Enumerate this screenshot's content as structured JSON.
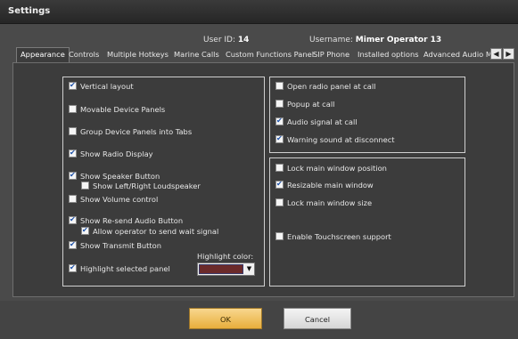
{
  "window": {
    "title": "Settings"
  },
  "user": {
    "id_label": "User ID:",
    "id_value": "14",
    "username_label": "Username:",
    "username_value": "Mimer Operator 13"
  },
  "tabs": [
    {
      "label": "Appearance",
      "active": true
    },
    {
      "label": "Controls"
    },
    {
      "label": "Multiple Hotkeys"
    },
    {
      "label": "Marine Calls"
    },
    {
      "label": "Custom Functions Panel"
    },
    {
      "label": "SIP Phone"
    },
    {
      "label": "Installed options"
    },
    {
      "label": "Advanced Audio Me"
    }
  ],
  "left_options": [
    {
      "label": "Vertical layout",
      "checked": true
    },
    {
      "label": "Movable Device Panels",
      "checked": false
    },
    {
      "label": "Group Device Panels into Tabs",
      "checked": false
    },
    {
      "label": "Show Radio Display",
      "checked": true
    },
    {
      "label": "Show Speaker Button",
      "checked": true
    },
    {
      "label": "Show Left/Right Loudspeaker",
      "checked": false
    },
    {
      "label": "Show Volume control",
      "checked": false
    },
    {
      "label": "Show Re-send Audio Button",
      "checked": true
    },
    {
      "label": "Allow operator to send wait signal",
      "checked": true
    },
    {
      "label": "Show Transmit Button",
      "checked": true
    },
    {
      "label": "Highlight selected panel",
      "checked": true
    }
  ],
  "highlight": {
    "label": "Highlight color:",
    "color": "#6b2a2a"
  },
  "right_top_options": [
    {
      "label": "Open radio panel at call",
      "checked": false
    },
    {
      "label": "Popup at call",
      "checked": false
    },
    {
      "label": "Audio signal at call",
      "checked": true
    },
    {
      "label": "Warning sound at disconnect",
      "checked": true
    }
  ],
  "right_bottom_options": [
    {
      "label": "Lock main window position",
      "checked": false
    },
    {
      "label": "Resizable main window",
      "checked": true
    },
    {
      "label": "Lock main window size",
      "checked": false
    },
    {
      "label": "Enable Touchscreen support",
      "checked": false
    }
  ],
  "buttons": {
    "ok": "OK",
    "cancel": "Cancel"
  }
}
